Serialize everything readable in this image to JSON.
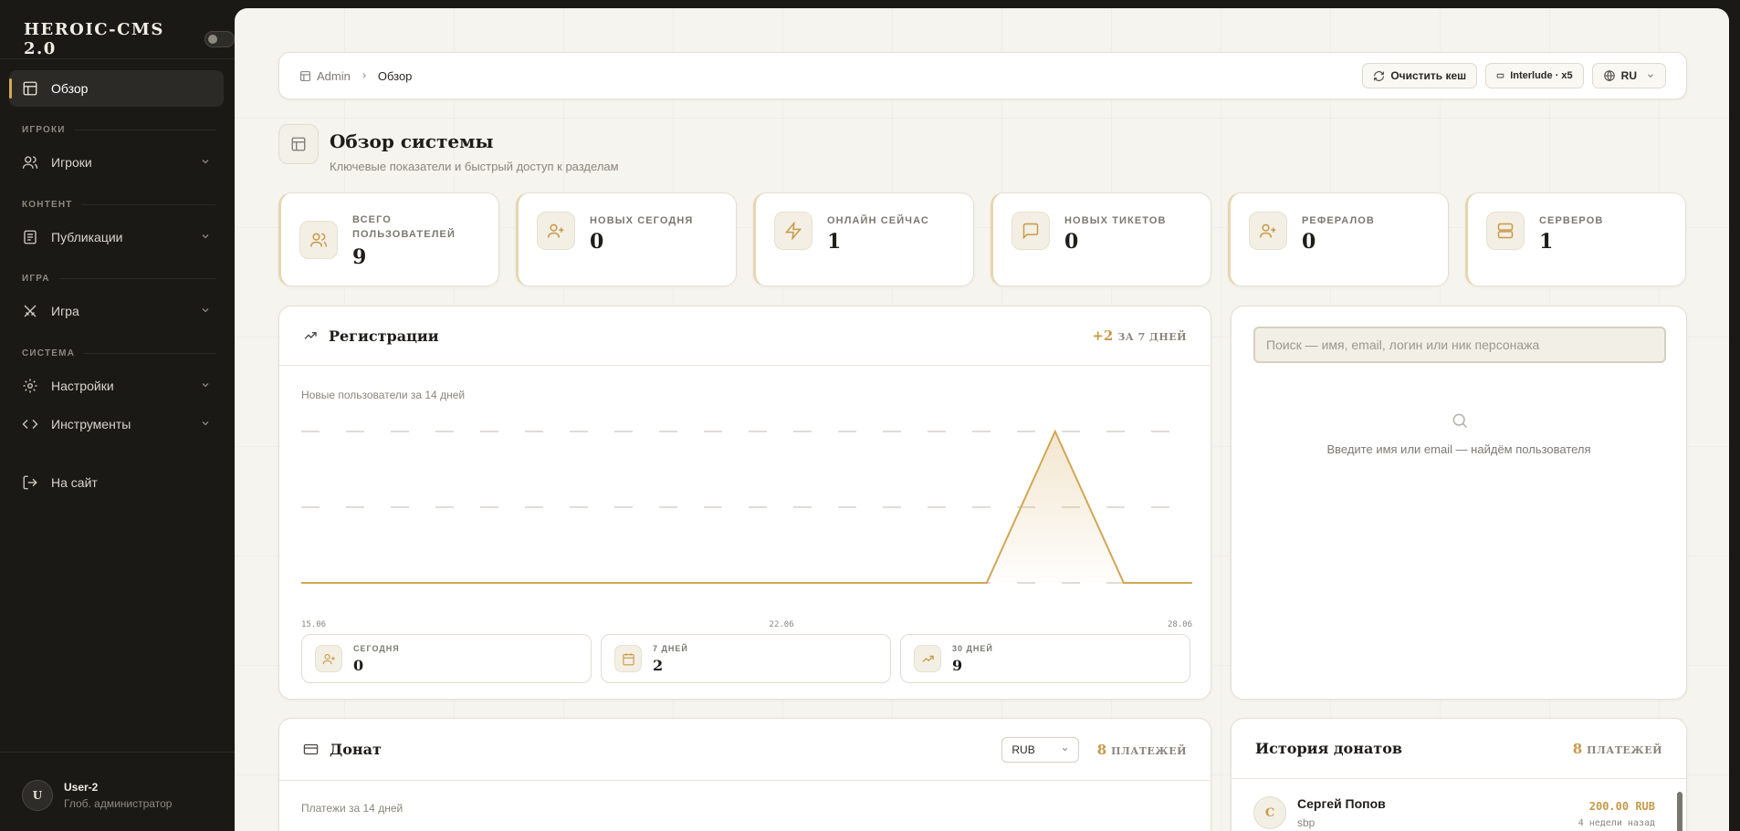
{
  "brand": {
    "title": "HEROIC-CMS 2.0"
  },
  "sidebar": {
    "overview": "Обзор",
    "section_players": "ИГРОКИ",
    "players": "Игроки",
    "section_content": "КОНТЕНТ",
    "publications": "Публикации",
    "section_game": "ИГРА",
    "game": "Игра",
    "section_system": "СИСТЕМА",
    "settings": "Настройки",
    "tools": "Инструменты",
    "to_site": "На сайт"
  },
  "user": {
    "initial": "U",
    "name": "User-2",
    "role": "Глоб. администратор"
  },
  "topbar": {
    "crumb_root": "Admin",
    "crumb_current": "Обзор",
    "clear_cache": "Очистить кеш",
    "server": "Interlude · x5",
    "lang": "RU"
  },
  "page": {
    "title": "Обзор системы",
    "subtitle": "Ключевые показатели и быстрый доступ к разделам"
  },
  "stats": [
    {
      "label": "Всего пользователей",
      "value": "9"
    },
    {
      "label": "Новых сегодня",
      "value": "0"
    },
    {
      "label": "Онлайн сейчас",
      "value": "1"
    },
    {
      "label": "Новых тикетов",
      "value": "0"
    },
    {
      "label": "Рефералов",
      "value": "0"
    },
    {
      "label": "Серверов",
      "value": "1"
    }
  ],
  "registrations": {
    "title": "Регистрации",
    "delta": "+2",
    "delta_label": "ЗА 7 ДНЕЙ",
    "subtitle": "Новые пользователи за 14 дней",
    "mini": [
      {
        "label": "СЕГОДНЯ",
        "value": "0"
      },
      {
        "label": "7 ДНЕЙ",
        "value": "2"
      },
      {
        "label": "30 ДНЕЙ",
        "value": "9"
      }
    ]
  },
  "chart_data": {
    "type": "area",
    "x": [
      "15.06",
      "16.06",
      "17.06",
      "18.06",
      "19.06",
      "20.06",
      "21.06",
      "22.06",
      "23.06",
      "24.06",
      "25.06",
      "26.06",
      "27.06",
      "28.06"
    ],
    "tick_labels": [
      "15.06",
      "22.06",
      "28.06"
    ],
    "values": [
      0,
      0,
      0,
      0,
      0,
      0,
      0,
      0,
      0,
      0,
      0,
      2,
      0,
      0
    ],
    "ylim": [
      0,
      2
    ],
    "grid": true,
    "color": "#d2a654"
  },
  "search": {
    "placeholder": "Поиск — имя, email, логин или ник персонажа",
    "empty_text": "Введите имя или email — найдём пользователя"
  },
  "donate": {
    "title": "Донат",
    "currency": "RUB",
    "count": "8",
    "count_label": "ПЛАТЕЖЕЙ",
    "subtitle": "Платежи за 14 дней"
  },
  "history": {
    "title": "История донатов",
    "count": "8",
    "count_label": "ПЛАТЕЖЕЙ",
    "rows": [
      {
        "initial": "С",
        "name": "Сергей Попов",
        "method": "sbp",
        "amount": "200.00 RUB",
        "time": "4 недели назад"
      }
    ]
  },
  "colors": {
    "accent": "#d2a654",
    "sidebar": "#1a1916",
    "main_bg": "#f6f4ef"
  }
}
